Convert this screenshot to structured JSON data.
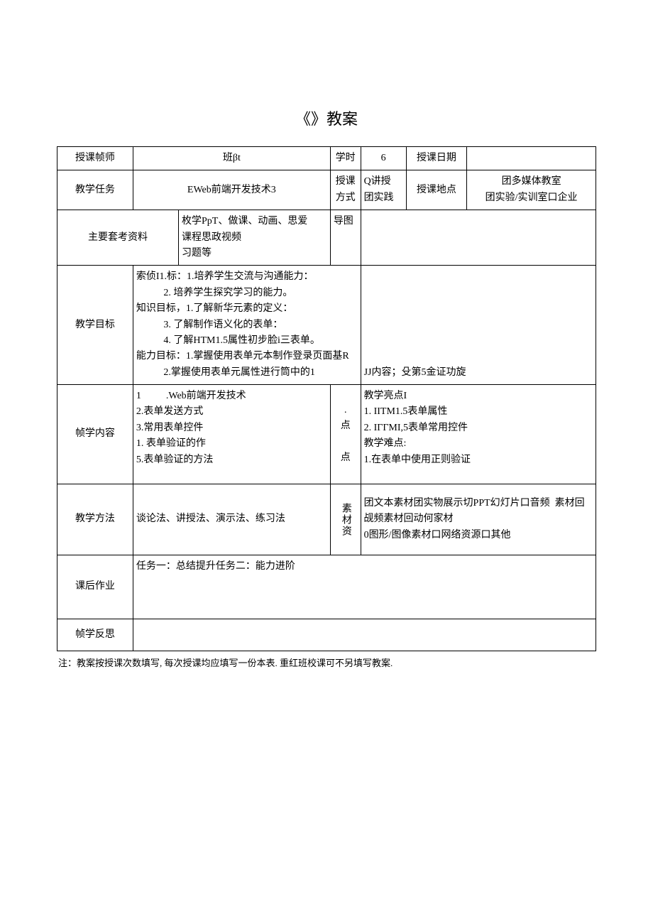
{
  "title": "《》教案",
  "row1": {
    "l_teacher": "授课帧师",
    "l_class": "班βt",
    "l_hours": "学时",
    "v_hours": "6",
    "l_date": "授课日期",
    "v_date": ""
  },
  "row2": {
    "l_task": "教学任务",
    "v_task": "EWeb前端开发技术3",
    "l_mode": "授课\n方式",
    "v_mode": "Q讲授\n团实践",
    "l_place": "授课地点",
    "v_place": "团多媒体教室\n团实验/实训室口企业"
  },
  "row3": {
    "l_ref": "主要套考资料",
    "v_ref": "枚学PpT、做课、动画、思爱\n课程思政视频\n习题等",
    "extra": "导图"
  },
  "row4": {
    "l_goal": "教学目标",
    "v_goal": "索侦I1.标：1.培养学生交流与沟通能力：\n           2. 培养学生探究学习的能力。\n知识目标，1.了解新华元素的定义：\n           3. 了解制作语义化的表单：\n           4. 了解HTM1.5属性初步脸i三表单。\n能力目标：1.掌握使用表单元本制作登录页面基R\n           2.掌握使用表单元属性进行筒中的1",
    "side": "JJ内容；殳第5金证功旋"
  },
  "row5": {
    "l_content": "帧学内容",
    "v_content": "1          .Web前端开发技术\n2.表单发送方式\n3.常用表单控件\n1. 表单验证的作\n5.表单验证的方法",
    "mid": ".\n点\n\n点",
    "right": "教学亮点I\n1. IITM1.5表单属性\n2. IГГMI,5表单常用控件\n教学难点:\n1.在表单中使用正则验证"
  },
  "row6": {
    "l_method": "教学方法",
    "v_method": "谈论法、讲授法、演示法、练习法",
    "mid": "素材资",
    "right": "团文本素材团实物展示切PPT幻灯片口音频  素材回觇频素材回动何家材\n0图形/图像素材口网络资源口其他"
  },
  "row7": {
    "l_hw": "课后作业",
    "v_hw": "任务一：总结提升任务二：能力进阶"
  },
  "row8": {
    "l_refl": "帧学反思",
    "v_refl": ""
  },
  "footnote": "注：教案按授课次数填写, 每次授课均应填写一份本表. 重红班校课可不另填写教案."
}
